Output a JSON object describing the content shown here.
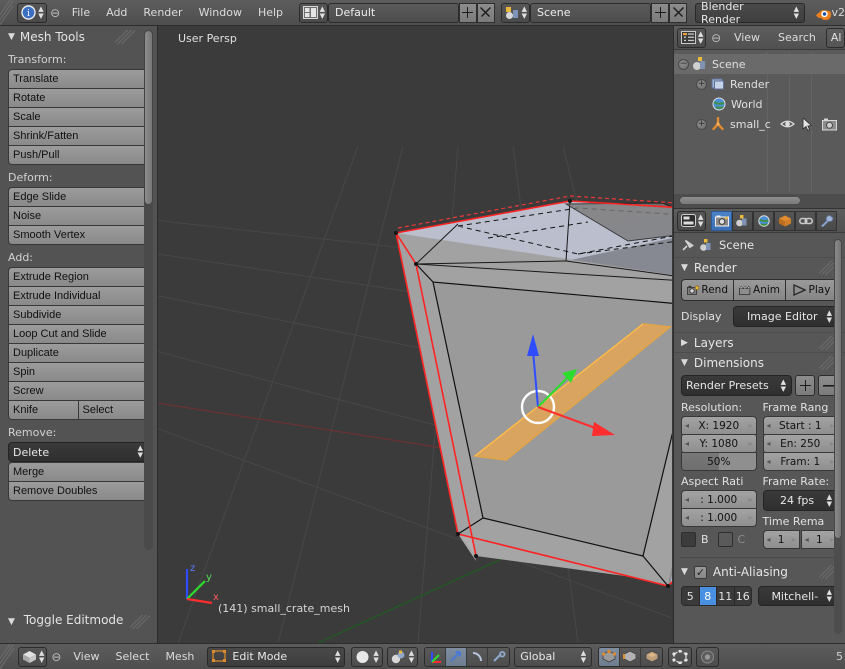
{
  "topbar": {
    "menu": [
      "File",
      "Add",
      "Render",
      "Window",
      "Help"
    ],
    "screen_layout": "Default",
    "scene_name": "Scene",
    "engine": "Blender Render",
    "version_partial": "v2",
    "add_label": "+",
    "remove_label": "✕"
  },
  "toolshelf": {
    "title": "Mesh Tools",
    "groups": [
      {
        "label": "Transform:",
        "items": [
          "Translate",
          "Rotate",
          "Scale",
          "Shrink/Fatten",
          "Push/Pull"
        ]
      },
      {
        "label": "Deform:",
        "items": [
          "Edge Slide",
          "Noise",
          "Smooth Vertex"
        ]
      },
      {
        "label": "Add:",
        "items": [
          "Extrude Region",
          "Extrude Individual",
          "Subdivide",
          "Loop Cut and Slide",
          "Duplicate",
          "Spin",
          "Screw"
        ]
      }
    ],
    "knife_row": [
      "Knife",
      "Select"
    ],
    "remove_label": "Remove:",
    "remove_dropdown": "Delete",
    "remove_items": [
      "Merge",
      "Remove Doubles"
    ],
    "footer_panel": "Toggle Editmode"
  },
  "viewport": {
    "view_label": "User Persp",
    "object_info": "(141) small_crate_mesh",
    "axis_x": "x",
    "axis_y": "y",
    "axis_z": "z"
  },
  "outliner": {
    "menu": [
      "View",
      "Search"
    ],
    "filter_partial": "Al",
    "rows": [
      {
        "label": "Scene",
        "indent": 0,
        "icon": "scene-icon",
        "selected": true,
        "expander": "−"
      },
      {
        "label": "Render",
        "indent": 1,
        "icon": "render-icon",
        "selected": false,
        "expander": "+"
      },
      {
        "label": "World",
        "indent": 1,
        "icon": "world-icon",
        "selected": false,
        "expander": ""
      },
      {
        "label": "small_c",
        "indent": 1,
        "icon": "armature-icon",
        "selected": false,
        "expander": "+"
      }
    ]
  },
  "properties": {
    "tabs": [
      "render-tab",
      "scene-tab",
      "world-tab",
      "object-tab",
      "constraint-tab",
      "modifier-tab"
    ],
    "active_tab_index": 0,
    "breadcrumb": "Scene",
    "render": {
      "section_title": "Render",
      "buttons": [
        "Rend",
        "Anim",
        "Play"
      ],
      "display_label": "Display",
      "display_value": "Image Editor"
    },
    "layers": {
      "section_title": "Layers"
    },
    "dimensions": {
      "section_title": "Dimensions",
      "preset": "Render Presets",
      "preset_add": "+",
      "preset_remove": "−",
      "resolution_label": "Resolution:",
      "resolution_x": "X: 1920",
      "resolution_y": "Y: 1080",
      "resolution_pct": "50%",
      "frame_range_label": "Frame Rang",
      "frame_start": "Start : 1",
      "frame_end": "En: 250",
      "frame_step": "Fram: 1",
      "aspect_label": "Aspect Rati",
      "aspect_x": ": 1.000",
      "aspect_y": ": 1.000",
      "border_label": "B",
      "crop_label": "C",
      "frame_rate_label": "Frame Rate:",
      "frame_rate": "24 fps",
      "time_remap_label": "Time Rema",
      "time_remap_old": "1",
      "time_remap_new": "1"
    },
    "antialiasing": {
      "section_title": "Anti-Aliasing",
      "enabled": true,
      "samples": [
        "5",
        "8",
        "11",
        "16"
      ],
      "active_sample_index": 1,
      "filter": "Mitchell-"
    }
  },
  "bottombar": {
    "menu": [
      "View",
      "Select",
      "Mesh"
    ],
    "mode": "Edit Mode",
    "transform_orientation": "Global",
    "select_modes": [
      "vertex-select",
      "edge-select",
      "face-select"
    ],
    "active_select_mode_index": 0,
    "pivot_icons": [
      "pivot-icon",
      "snap-icon"
    ],
    "manipulator_icons": [
      "translate-manip-icon",
      "rotate-manip-icon",
      "scale-manip-icon"
    ],
    "active_manipulator_index": 0,
    "occlude_icon": "occlude-geometry-icon",
    "proportional_icon": "proportional-edit-icon",
    "cutoff_text": "5"
  },
  "colors": {
    "accent_blue": "#4a90e2",
    "selected_edge": "#ff2b2b",
    "active_face": "#f5a623",
    "axis_x": "#ff2d2d",
    "axis_y": "#2ddd2d",
    "axis_z": "#2d4dff",
    "panel_bg": "#535353",
    "viewport_bg": "#3b3b3b"
  }
}
